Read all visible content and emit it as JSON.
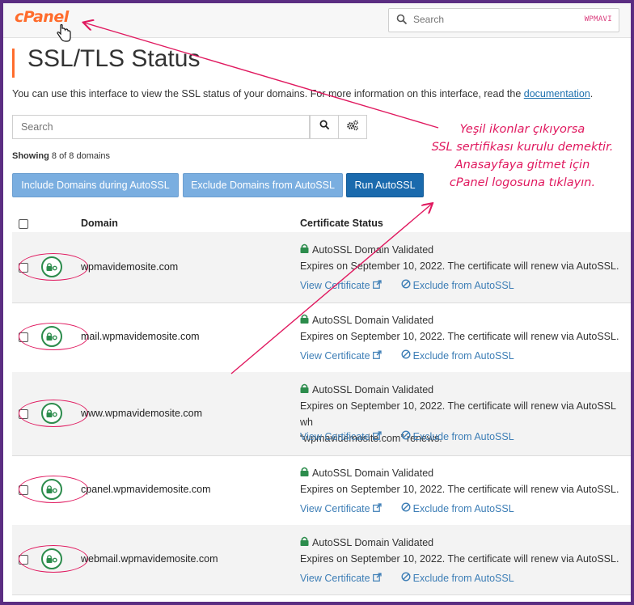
{
  "header": {
    "logo": "cPanel",
    "search_placeholder": "Search",
    "watermark": "WPMAVI"
  },
  "page": {
    "title": "SSL/TLS Status",
    "description": "You can use this interface to view the SSL status of your domains. For more information on this interface, read the",
    "doc_link": "documentation",
    "doc_suffix": "."
  },
  "filter": {
    "search_placeholder": "Search",
    "showing_label": "Showing",
    "showing_rest": "8 of 8 domains"
  },
  "toolbar": {
    "include_label": "Include Domains during AutoSSL",
    "exclude_label": "Exclude Domains from AutoSSL",
    "run_label": "Run AutoSSL"
  },
  "table": {
    "col_domain": "Domain",
    "col_status": "Certificate Status",
    "rows": [
      {
        "domain": "wpmavidemosite.com",
        "status": "AutoSSL Domain Validated",
        "expiry": "Expires on September 10, 2022. The certificate will renew via AutoSSL.",
        "view": "View Certificate",
        "exclude": "Exclude from AutoSSL"
      },
      {
        "domain": "mail.wpmavidemosite.com",
        "status": "AutoSSL Domain Validated",
        "expiry": "Expires on September 10, 2022. The certificate will renew via AutoSSL.",
        "view": "View Certificate",
        "exclude": "Exclude from AutoSSL"
      },
      {
        "domain": "www.wpmavidemosite.com",
        "status": "AutoSSL Domain Validated",
        "expiry": "Expires on September 10, 2022. The certificate will renew via AutoSSL wh",
        "expiry2": "“wpmavidemosite.com” renews.",
        "view": "View Certificate",
        "exclude": "Exclude from AutoSSL"
      },
      {
        "domain": "cpanel.wpmavidemosite.com",
        "status": "AutoSSL Domain Validated",
        "expiry": "Expires on September 10, 2022. The certificate will renew via AutoSSL.",
        "view": "View Certificate",
        "exclude": "Exclude from AutoSSL"
      },
      {
        "domain": "webmail.wpmavidemosite.com",
        "status": "AutoSSL Domain Validated",
        "expiry": "Expires on September 10, 2022. The certificate will renew via AutoSSL.",
        "view": "View Certificate",
        "exclude": "Exclude from AutoSSL"
      }
    ]
  },
  "annotation": {
    "line1": "Yeşil ikonlar çıkıyorsa",
    "line2": "SSL sertifikası kurulu demektir.",
    "line3": "Anasayfaya gitmet için",
    "line4": "cPanel logosuna tıklayın."
  },
  "colors": {
    "accent": "#ff6c2c",
    "annotation": "#e0195f",
    "success": "#2c8c4c",
    "link": "#3d7eb6",
    "primary": "#1a6aad"
  }
}
